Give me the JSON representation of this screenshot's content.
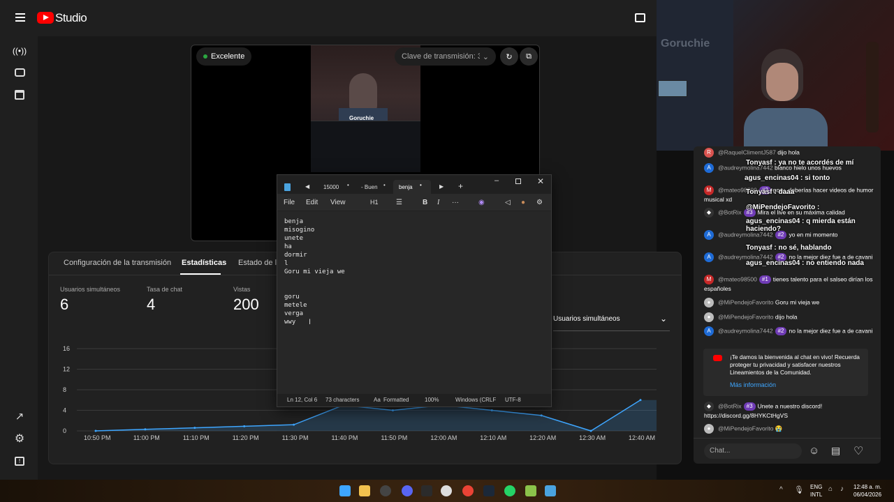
{
  "studio": {
    "logo_text": "Studio",
    "preview_status": "Excelente",
    "stream_key_label": "Clave de transmisión: 30 S",
    "tabs": [
      "Configuración de la transmisión",
      "Estadísticas",
      "Estado de la"
    ],
    "stats": [
      {
        "label": "Usuarios simultáneos",
        "value": "6"
      },
      {
        "label": "Tasa de chat",
        "value": "4"
      },
      {
        "label": "Vistas",
        "value": "200"
      }
    ],
    "metric_select": "Usuarios simultáneos"
  },
  "chart_data": {
    "type": "area",
    "ylabel": "",
    "xlabel": "",
    "ylim": [
      0,
      16
    ],
    "yticks": [
      "16",
      "12",
      "8",
      "4",
      "0"
    ],
    "x": [
      "10:50 PM",
      "11:00 PM",
      "11:10 PM",
      "11:20 PM",
      "11:30 PM",
      "11:40 PM",
      "11:50 PM",
      "12:00 AM",
      "12:10 AM",
      "12:20 AM",
      "12:30 AM",
      "12:40 AM"
    ],
    "series": [
      {
        "values": [
          0,
          0.3,
          0.6,
          0.9,
          1.2,
          5,
          4,
          5,
          4,
          3,
          0,
          6
        ]
      }
    ],
    "color": "#3ea6ff"
  },
  "notepad": {
    "tabs": [
      "15000",
      "- Buen",
      "benja"
    ],
    "menu": [
      "File",
      "Edit",
      "View"
    ],
    "heading": "H1",
    "lines": [
      "benja",
      "misogino",
      "unete",
      "ha",
      "dormir",
      "l",
      "Goru mi vieja we",
      "",
      "",
      "goru",
      "metele",
      "verga",
      "wwy"
    ],
    "status": {
      "position": "Ln 12, Col 6",
      "count": "73 characters",
      "format": "Formatted",
      "zoom": "100%",
      "eol": "Windows (CRLF",
      "encoding": "UTF-8"
    }
  },
  "webcam": {
    "brand": "Goruchie"
  },
  "chat": {
    "messages": [
      {
        "user": "@RaquelClimentJ587",
        "text": "dijo hola",
        "avatar": "R",
        "color": "#d9534f"
      },
      {
        "user": "@audreymolina7442",
        "text": "blanco hielo unos huevos",
        "avatar": "A",
        "color": "#1e6bd6"
      },
      {
        "user": "@mateo98500",
        "badge": "#2",
        "text": "goru, deberías hacer videos de humor musical xd",
        "avatar": "M",
        "color": "#c62828"
      },
      {
        "user": "@BotRix",
        "badge": "#3",
        "text": "Mira el live en su máxima calidad",
        "avatar": "◆",
        "color": "#333333"
      },
      {
        "user": "@audreymolina7442",
        "badge": "#2",
        "text": "yo en mi momento",
        "avatar": "A",
        "color": "#1e6bd6"
      },
      {
        "user": "@audreymolina7442",
        "badge": "#2",
        "text": "no la mejor diez fue a de cavani",
        "avatar": "A",
        "color": "#1e6bd6"
      },
      {
        "user": "@mateo98500",
        "badge": "#1",
        "text": "tienes talento para el salseo dirían los españoles",
        "avatar": "M",
        "color": "#c62828"
      },
      {
        "user": "@MiPendejoFavorito",
        "text": "Goru mi vieja we",
        "avatar": "●",
        "color": "#bbbbbb"
      },
      {
        "user": "@MiPendejoFavorito",
        "text": "dijo hola",
        "avatar": "●",
        "color": "#bbbbbb"
      },
      {
        "user": "@audreymolina7442",
        "badge": "#2",
        "text": "no la mejor diez fue a de cavani",
        "avatar": "A",
        "color": "#1e6bd6"
      }
    ],
    "notice": "¡Te damos la bienvenida al chat en vivo! Recuerda proteger tu privacidad y satisfacer nuestros Lineamientos de la Comunidad.",
    "notice_link": "Más información",
    "after": [
      {
        "user": "@BotRix",
        "badge": "#3",
        "text": "Unete a nuestro discord! https://discord.gg/8HYKCtHgVS",
        "avatar": "◆",
        "color": "#333333"
      },
      {
        "user": "@MiPendejoFavorito",
        "text": "😭",
        "avatar": "●",
        "color": "#bbbbbb"
      }
    ],
    "input_placeholder": "Chat...",
    "overlays": [
      "Tonyasf : ya no te acordés de mí",
      "agus_encinas04 : si tonto",
      "Tonyasf : daaa",
      "@MiPendejoFavorito :",
      "agus_encinas04 : q mierda están haciendo?",
      "Tonyasf : no sé, hablando",
      "agus_encinas04 : no entiendo nada"
    ]
  },
  "taskbar": {
    "lang": "ENG",
    "layout": "INTL",
    "time": "12:48 a. m.",
    "date": "06/04/2026"
  }
}
